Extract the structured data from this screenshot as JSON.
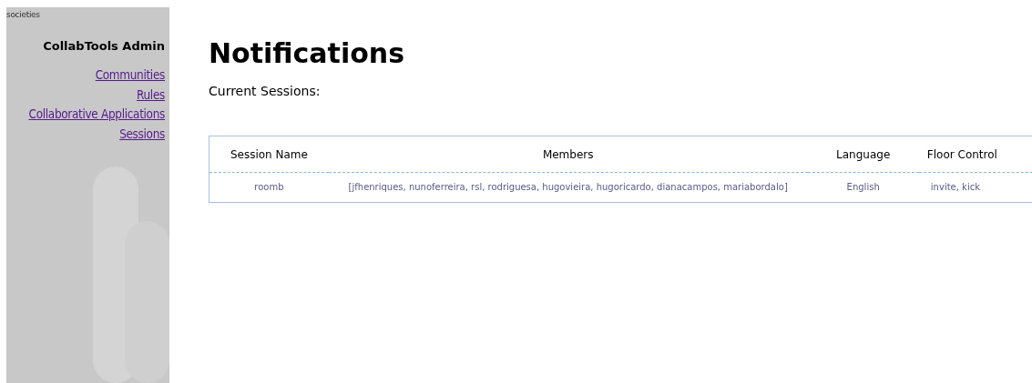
{
  "sidebar": {
    "logo": "societies",
    "title": "CollabTools Admin",
    "links": [
      {
        "label": "Communities"
      },
      {
        "label": "Rules"
      },
      {
        "label": "Collaborative Applications"
      },
      {
        "label": "Sessions"
      }
    ]
  },
  "main": {
    "heading": "Notifications",
    "subheading": "Current Sessions:",
    "table": {
      "columns": [
        "Session Name",
        "Members",
        "Language",
        "Floor Control"
      ],
      "rows": [
        [
          "roomb",
          "[jfhenriques, nunoferreira, rsl, rodriguesa, hugovieira, hugoricardo, dianacampos, mariabordalo]",
          "English",
          "invite, kick"
        ]
      ]
    }
  }
}
